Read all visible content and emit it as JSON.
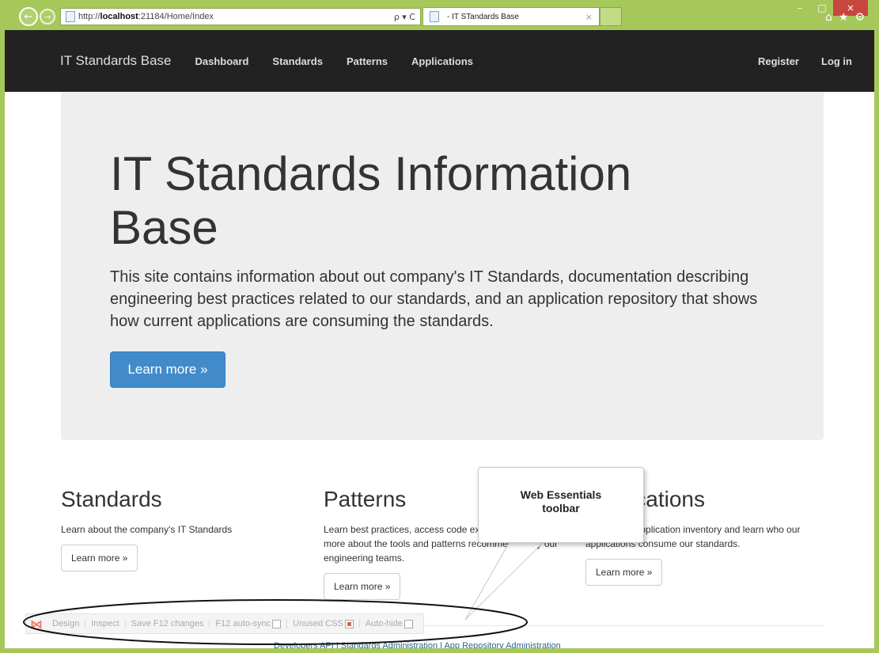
{
  "browser": {
    "url_prefix": "http://",
    "url_host": "localhost",
    "url_rest": ":21184/Home/Index",
    "url_tools": "ρ ▾ C",
    "tab_title": "- IT STandards Base",
    "tab_close": "×",
    "back_glyph": "←",
    "forward_glyph": "→",
    "controls": {
      "minimize": "–",
      "maximize": "□",
      "close": "×"
    },
    "right_icons": {
      "home": "⌂",
      "favorites": "★",
      "settings": "⚙"
    }
  },
  "navbar": {
    "brand": "IT Standards Base",
    "links": [
      "Dashboard",
      "Standards",
      "Patterns",
      "Applications"
    ],
    "right_links": [
      "Register",
      "Log in"
    ]
  },
  "jumbotron": {
    "title": "IT Standards Information Base",
    "lead": "This site contains information about out company's IT Standards, documentation describing engineering best practices related to our standards, and an application repository that shows how current applications are consuming the standards.",
    "button": "Learn more »"
  },
  "columns": [
    {
      "heading": "Standards",
      "text": "Learn about the company's IT Standards",
      "button": "Learn more »"
    },
    {
      "heading": "Patterns",
      "text": "Learn best practices, access code examples, and learn more about the tools and patterns recommended by our engineering teams.",
      "button": "Learn more »"
    },
    {
      "heading": "Applications",
      "text": "Access our application inventory and learn who our applications consume our standards.",
      "button": "Learn more »"
    }
  ],
  "we_toolbar": {
    "items": [
      "Design",
      "Inspect",
      "Save F12 changes",
      "F12 auto-sync",
      "Unused CSS",
      "Auto-hide"
    ]
  },
  "footer": {
    "links": "Developers API | Standards Administration | App Repository Administration"
  },
  "callout": {
    "line1": "Web Essentials",
    "line2": "toolbar"
  },
  "colors": {
    "window_frame": "#a6c85a",
    "navbar": "#222222",
    "jumbotron": "#eeeeee",
    "primary": "#428bca"
  }
}
